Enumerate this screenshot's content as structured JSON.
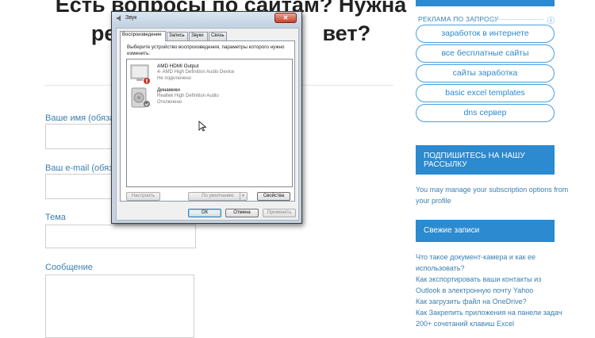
{
  "page": {
    "heading_line1": "Есть вопросы по сайтам? Нужна",
    "heading_line2_left": "ре",
    "heading_line2_right": "вет?",
    "form": {
      "name_label": "Ваше имя (обязате",
      "email_label": "Ваш e-mail (обязате",
      "topic_label": "Тема",
      "message_label": "Сообщение"
    }
  },
  "sidebar": {
    "ad_label": "РЕКЛАМА ПО ЗАПРОСУ",
    "ad_info": "ⓘ",
    "ad_links": [
      "заработок в интернете",
      "все бесплатные сайты",
      "сайты заработка",
      "basic excel templates",
      "dns сервер"
    ],
    "subscribe_title": "ПОДПИШИТЕСЬ НА НАШУ РАССЫЛКУ",
    "subscribe_text": "You may manage your subscription options from your profile",
    "recent_title": "Свежие записи",
    "recent_posts": [
      "Что такое документ-камера и как ее",
      "использовать?",
      "Как экспортировать ваши контакты из",
      "Outlook в электронную почту Yahoo",
      "Как загрузить файл на OneDrive?",
      "Как Закрепить приложения на панели задач",
      "200+ сочетаний клавиш Excel"
    ]
  },
  "dialog": {
    "title": "Звук",
    "close_glyph": "✕",
    "tabs": [
      "Воспроизведение",
      "Запись",
      "Звуки",
      "Связь"
    ],
    "prompt": "Выберите устройство воспроизведения, параметры которого нужно изменить:",
    "devices": [
      {
        "name": "AMD HDMI Output",
        "sub": "4- AMD High Definition Audio Device",
        "state": "Не подключено"
      },
      {
        "name": "Динамики",
        "sub": "Realtek High Definition Audio",
        "state": "Отключено"
      }
    ],
    "configure_label": "Настроить",
    "default_label": "По умолчанию",
    "properties_label": "Свойства",
    "ok_label": "ОК",
    "cancel_label": "Отмена",
    "apply_label": "Применить"
  }
}
